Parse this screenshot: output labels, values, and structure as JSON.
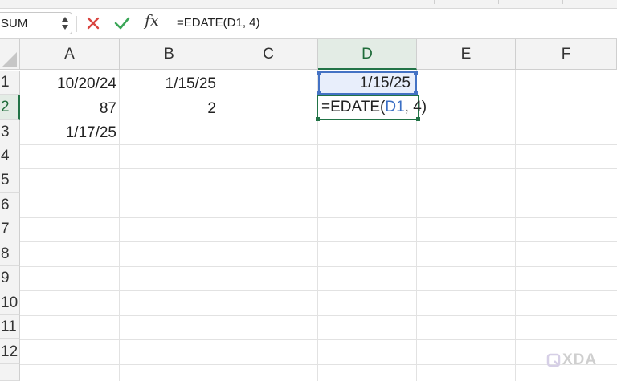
{
  "formula_bar": {
    "name_box": "SUM",
    "fx_label": "fx",
    "formula": "=EDATE(D1, 4)"
  },
  "columns": [
    "A",
    "B",
    "C",
    "D",
    "E",
    "F"
  ],
  "rows": [
    "1",
    "2",
    "3",
    "4",
    "5",
    "6",
    "7",
    "8",
    "9",
    "10",
    "11",
    "12"
  ],
  "cells": {
    "A1": "10/20/24",
    "B1": "1/15/25",
    "D1": "1/15/25",
    "A2": "87",
    "B2": "2",
    "A3": "1/17/25"
  },
  "editing": {
    "cell": "D2",
    "prefix": "=EDATE(",
    "ref": "D1",
    "suffix": ", 4)"
  },
  "watermark": "XDA",
  "colors": {
    "accent_green": "#217346",
    "ref_blue": "#3b6fc4",
    "cancel_red": "#d9443f",
    "confirm_green": "#3aa657"
  }
}
